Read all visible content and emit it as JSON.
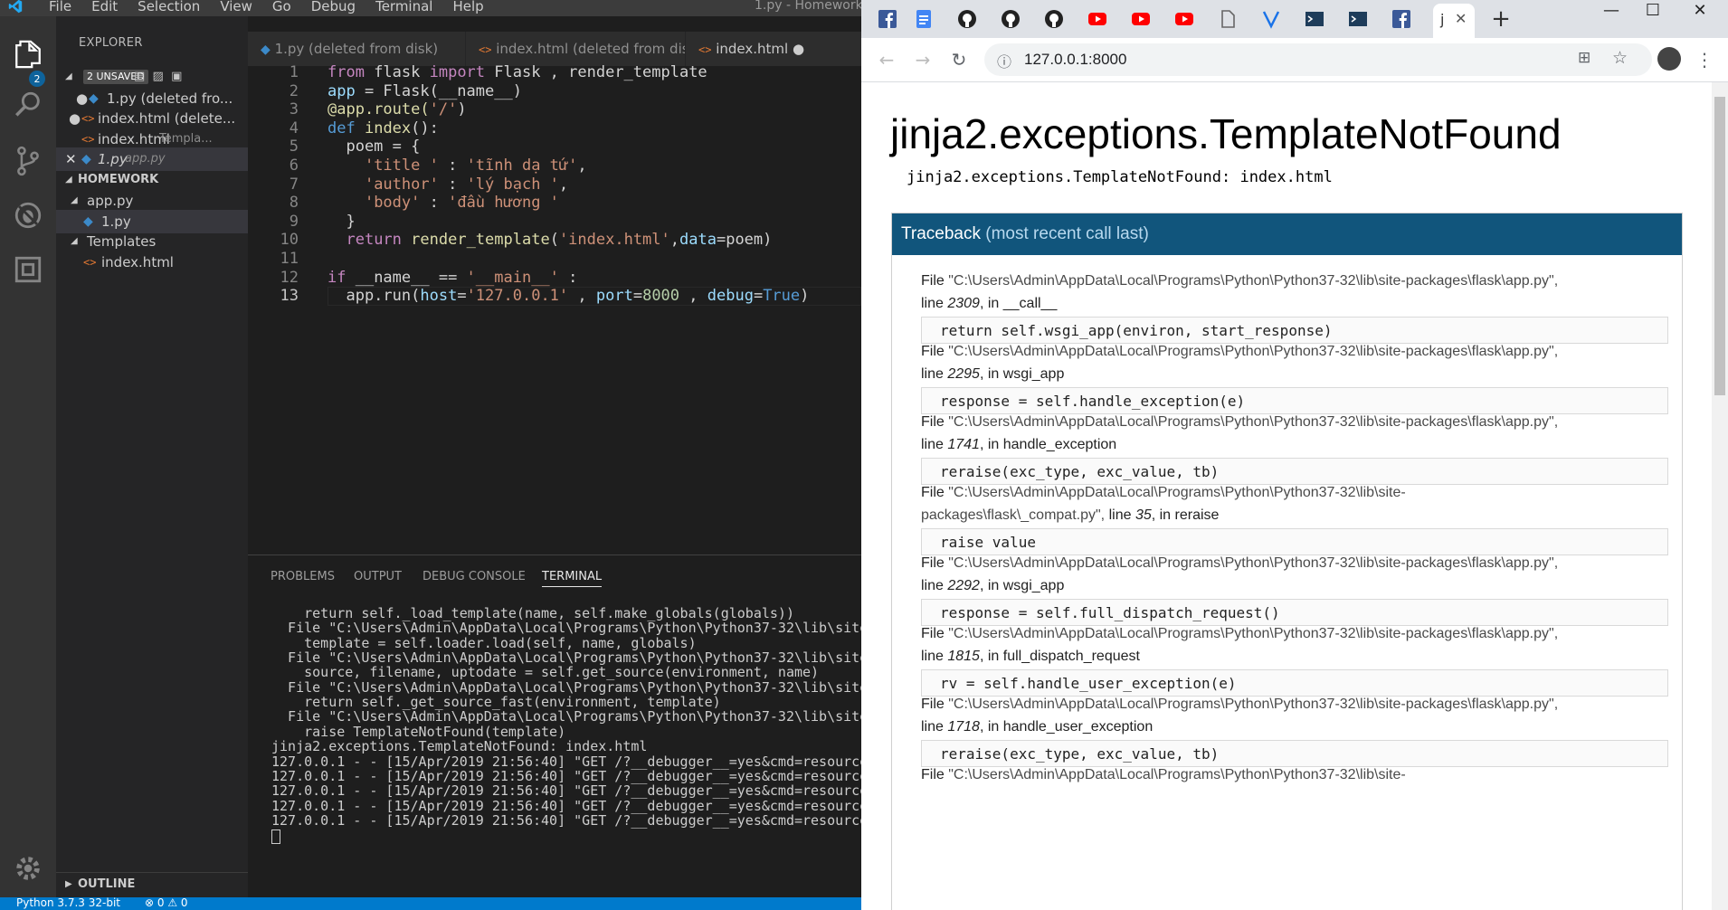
{
  "vscode": {
    "menu": [
      "File",
      "Edit",
      "Selection",
      "View",
      "Go",
      "Debug",
      "Terminal",
      "Help"
    ],
    "window_title": "1.py - Homework",
    "explorer_title": "EXPLORER",
    "scm_badge": "2",
    "open_editors": {
      "badge": "2 UNSAVED",
      "items": [
        {
          "name": "1.py (deleted fro...",
          "hint": ""
        },
        {
          "name": "index.html (delete...",
          "hint": ""
        },
        {
          "name": "index.html",
          "hint": "Templa..."
        },
        {
          "name": "1.py",
          "hint": "app.py"
        }
      ]
    },
    "workspace_title": "HOMEWORK",
    "tree": [
      "app.py",
      "1.py",
      "Templates",
      "index.html"
    ],
    "outline_title": "OUTLINE",
    "tabs": [
      "1.py (deleted from disk)",
      "index.html (deleted from disk)",
      "index.html"
    ],
    "line_numbers": [
      "1",
      "2",
      "3",
      "4",
      "5",
      "6",
      "7",
      "8",
      "9",
      "10",
      "11",
      "12",
      "13"
    ],
    "code": [
      [
        {
          "t": "from",
          "c": "k"
        },
        {
          "t": " flask ",
          "c": ""
        },
        {
          "t": "import",
          "c": "k"
        },
        {
          "t": " Flask , render_template",
          "c": ""
        }
      ],
      [
        {
          "t": "app",
          "c": "v"
        },
        {
          "t": " = Flask(__name__)",
          "c": ""
        }
      ],
      [
        {
          "t": "@app.route(",
          "c": "f"
        },
        {
          "t": "'/'",
          "c": "s"
        },
        {
          "t": ")",
          "c": ""
        }
      ],
      [
        {
          "t": "def",
          "c": "b"
        },
        {
          "t": " ",
          "c": ""
        },
        {
          "t": "index",
          "c": "f"
        },
        {
          "t": "():",
          "c": ""
        }
      ],
      [
        {
          "t": "  poem = {",
          "c": ""
        }
      ],
      [
        {
          "t": "    ",
          "c": ""
        },
        {
          "t": "'title '",
          "c": "s"
        },
        {
          "t": " : ",
          "c": ""
        },
        {
          "t": "'tĩnh dạ tứ'",
          "c": "s"
        },
        {
          "t": ",",
          "c": ""
        }
      ],
      [
        {
          "t": "    ",
          "c": ""
        },
        {
          "t": "'author'",
          "c": "s"
        },
        {
          "t": " : ",
          "c": ""
        },
        {
          "t": "'lý bạch '",
          "c": "s"
        },
        {
          "t": ",",
          "c": ""
        }
      ],
      [
        {
          "t": "    ",
          "c": ""
        },
        {
          "t": "'body'",
          "c": "s"
        },
        {
          "t": " : ",
          "c": ""
        },
        {
          "t": "'đầu hương '",
          "c": "s"
        }
      ],
      [
        {
          "t": "  }",
          "c": ""
        }
      ],
      [
        {
          "t": "  ",
          "c": ""
        },
        {
          "t": "return",
          "c": "k"
        },
        {
          "t": " ",
          "c": ""
        },
        {
          "t": "render_template",
          "c": "f"
        },
        {
          "t": "(",
          "c": ""
        },
        {
          "t": "'index.html'",
          "c": "s"
        },
        {
          "t": ",",
          "c": ""
        },
        {
          "t": "data",
          "c": "v"
        },
        {
          "t": "=poem)",
          "c": ""
        }
      ],
      [
        {
          "t": "",
          "c": ""
        }
      ],
      [
        {
          "t": "if",
          "c": "k"
        },
        {
          "t": " __name__ == ",
          "c": ""
        },
        {
          "t": "'__main__'",
          "c": "s"
        },
        {
          "t": " :",
          "c": ""
        }
      ],
      [
        {
          "t": "  app.run(",
          "c": ""
        },
        {
          "t": "host",
          "c": "v"
        },
        {
          "t": "=",
          "c": ""
        },
        {
          "t": "'127.0.0.1'",
          "c": "s"
        },
        {
          "t": " , ",
          "c": ""
        },
        {
          "t": "port",
          "c": "v"
        },
        {
          "t": "=",
          "c": ""
        },
        {
          "t": "8000",
          "c": "n"
        },
        {
          "t": " , ",
          "c": ""
        },
        {
          "t": "debug",
          "c": "v"
        },
        {
          "t": "=",
          "c": ""
        },
        {
          "t": "True",
          "c": "b"
        },
        {
          "t": ")",
          "c": ""
        }
      ]
    ],
    "panel_tabs": [
      "PROBLEMS",
      "OUTPUT",
      "DEBUG CONSOLE",
      "TERMINAL"
    ],
    "terminal": [
      "    return self._load_template(name, self.make_globals(globals))",
      "  File \"C:\\Users\\Admin\\AppData\\Local\\Programs\\Python\\Python37-32\\lib\\site",
      "    template = self.loader.load(self, name, globals)",
      "  File \"C:\\Users\\Admin\\AppData\\Local\\Programs\\Python\\Python37-32\\lib\\site",
      "    source, filename, uptodate = self.get_source(environment, name)",
      "  File \"C:\\Users\\Admin\\AppData\\Local\\Programs\\Python\\Python37-32\\lib\\site",
      "    return self._get_source_fast(environment, template)",
      "  File \"C:\\Users\\Admin\\AppData\\Local\\Programs\\Python\\Python37-32\\lib\\site",
      "    raise TemplateNotFound(template)",
      "jinja2.exceptions.TemplateNotFound: index.html",
      "127.0.0.1 - - [15/Apr/2019 21:56:40] \"GET /?__debugger__=yes&cmd=resource",
      "127.0.0.1 - - [15/Apr/2019 21:56:40] \"GET /?__debugger__=yes&cmd=resource",
      "127.0.0.1 - - [15/Apr/2019 21:56:40] \"GET /?__debugger__=yes&cmd=resource",
      "127.0.0.1 - - [15/Apr/2019 21:56:40] \"GET /?__debugger__=yes&cmd=resource",
      "127.0.0.1 - - [15/Apr/2019 21:56:40] \"GET /?__debugger__=yes&cmd=resource"
    ],
    "status": {
      "python": "Python 3.7.3 32-bit",
      "errors": "0",
      "warnings": "0"
    }
  },
  "chrome": {
    "active_tab_letter": "j",
    "url": "127.0.0.1:8000",
    "error_title": "jinja2.exceptions.TemplateNotFound",
    "error_message": "jinja2.exceptions.TemplateNotFound: index.html",
    "traceback_title": "Traceback",
    "traceback_sub": "(most recent call last)",
    "frames": [
      {
        "path1": "\"C:\\Users\\Admin\\AppData\\Local\\Programs\\Python\\Python37-32\\lib\\site-packages\\flask\\app.py\",",
        "path2": "",
        "line": "2309",
        "func": "__call__",
        "code": "return self.wsgi_app(environ, start_response)"
      },
      {
        "path1": "\"C:\\Users\\Admin\\AppData\\Local\\Programs\\Python\\Python37-32\\lib\\site-packages\\flask\\app.py\",",
        "path2": "",
        "line": "2295",
        "func": "wsgi_app",
        "code": "response = self.handle_exception(e)"
      },
      {
        "path1": "\"C:\\Users\\Admin\\AppData\\Local\\Programs\\Python\\Python37-32\\lib\\site-packages\\flask\\app.py\",",
        "path2": "",
        "line": "1741",
        "func": "handle_exception",
        "code": "reraise(exc_type, exc_value, tb)"
      },
      {
        "path1": "\"C:\\Users\\Admin\\AppData\\Local\\Programs\\Python\\Python37-32\\lib\\site-",
        "path2": "packages\\flask\\_compat.py\",",
        "line": "35",
        "func": "reraise",
        "code": "raise value"
      },
      {
        "path1": "\"C:\\Users\\Admin\\AppData\\Local\\Programs\\Python\\Python37-32\\lib\\site-packages\\flask\\app.py\",",
        "path2": "",
        "line": "2292",
        "func": "wsgi_app",
        "code": "response = self.full_dispatch_request()"
      },
      {
        "path1": "\"C:\\Users\\Admin\\AppData\\Local\\Programs\\Python\\Python37-32\\lib\\site-packages\\flask\\app.py\",",
        "path2": "",
        "line": "1815",
        "func": "full_dispatch_request",
        "code": "rv = self.handle_user_exception(e)"
      },
      {
        "path1": "\"C:\\Users\\Admin\\AppData\\Local\\Programs\\Python\\Python37-32\\lib\\site-packages\\flask\\app.py\",",
        "path2": "",
        "line": "1718",
        "func": "handle_user_exception",
        "code": "reraise(exc_type, exc_value, tb)"
      },
      {
        "path1": "\"C:\\Users\\Admin\\AppData\\Local\\Programs\\Python\\Python37-32\\lib\\site-",
        "path2": "",
        "line": "",
        "func": "",
        "code": ""
      }
    ],
    "frame_labels": {
      "file": "File ",
      "line": "line ",
      "in": ", in "
    }
  }
}
